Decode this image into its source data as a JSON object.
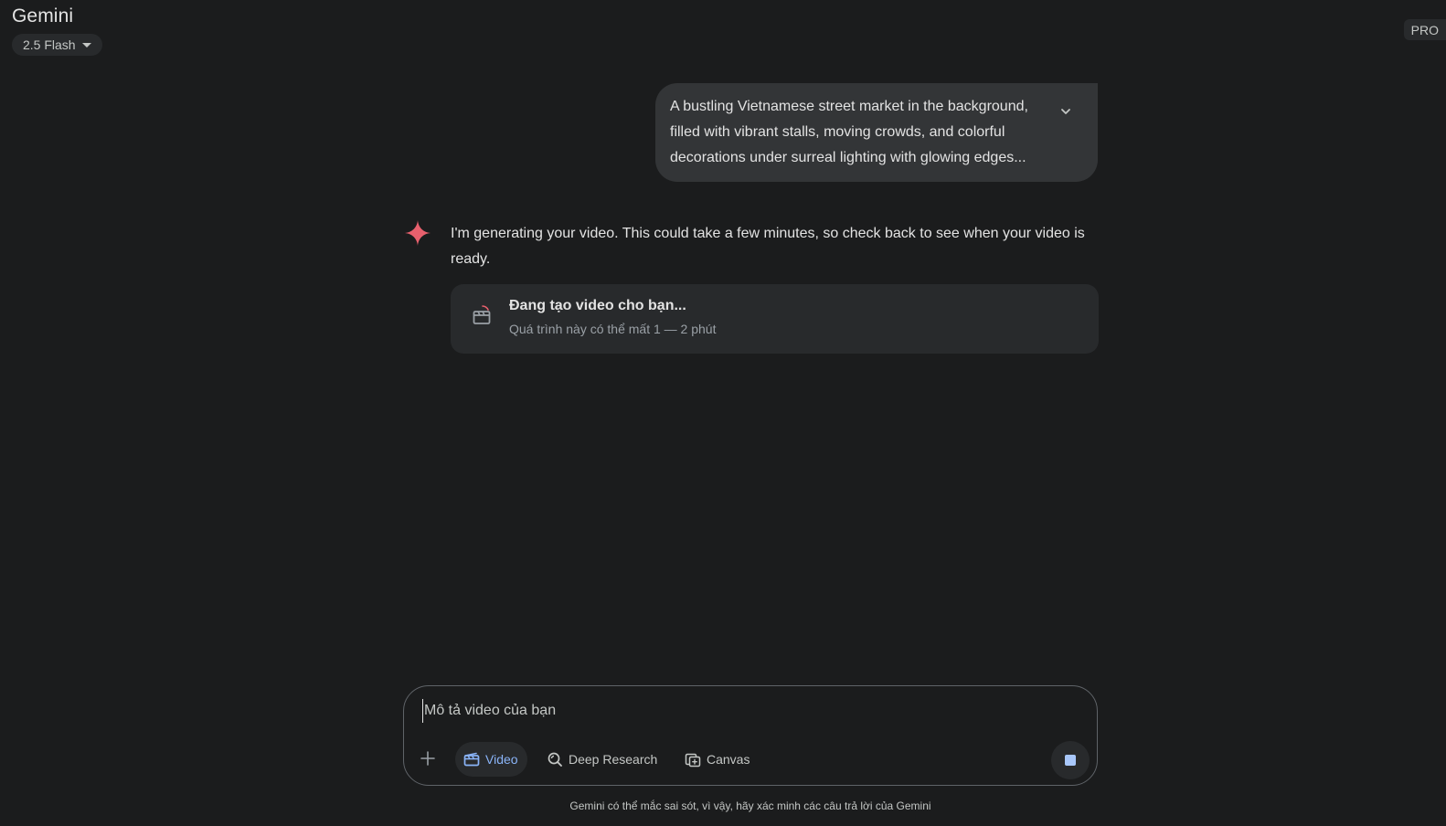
{
  "header": {
    "title": "Gemini",
    "model_label": "2.5 Flash",
    "pro_badge": "PRO"
  },
  "conversation": {
    "user_message": "A bustling Vietnamese street market in the background, filled with vibrant stalls, moving crowds, and colorful decorations under surreal lighting with glowing edges...",
    "assistant_message": "I'm generating your video. This could take a few minutes, so check back to see when your video is ready.",
    "video_card": {
      "title": "Đang tạo video cho bạn...",
      "subtitle": "Quá trình này có thể mất 1 — 2 phút"
    }
  },
  "composer": {
    "placeholder": "Mô tả video của bạn",
    "value": "",
    "tools": {
      "video": "Video",
      "deep_research": "Deep Research",
      "canvas": "Canvas"
    }
  },
  "footer": {
    "disclaimer": "Gemini có thể mắc sai sót, vì vậy, hãy xác minh các câu trả lời của Gemini"
  },
  "colors": {
    "background": "#1b1c1d",
    "surface": "#282a2c",
    "accent_blue": "#8ab4f8",
    "gemini_spark": "#e8606d"
  }
}
